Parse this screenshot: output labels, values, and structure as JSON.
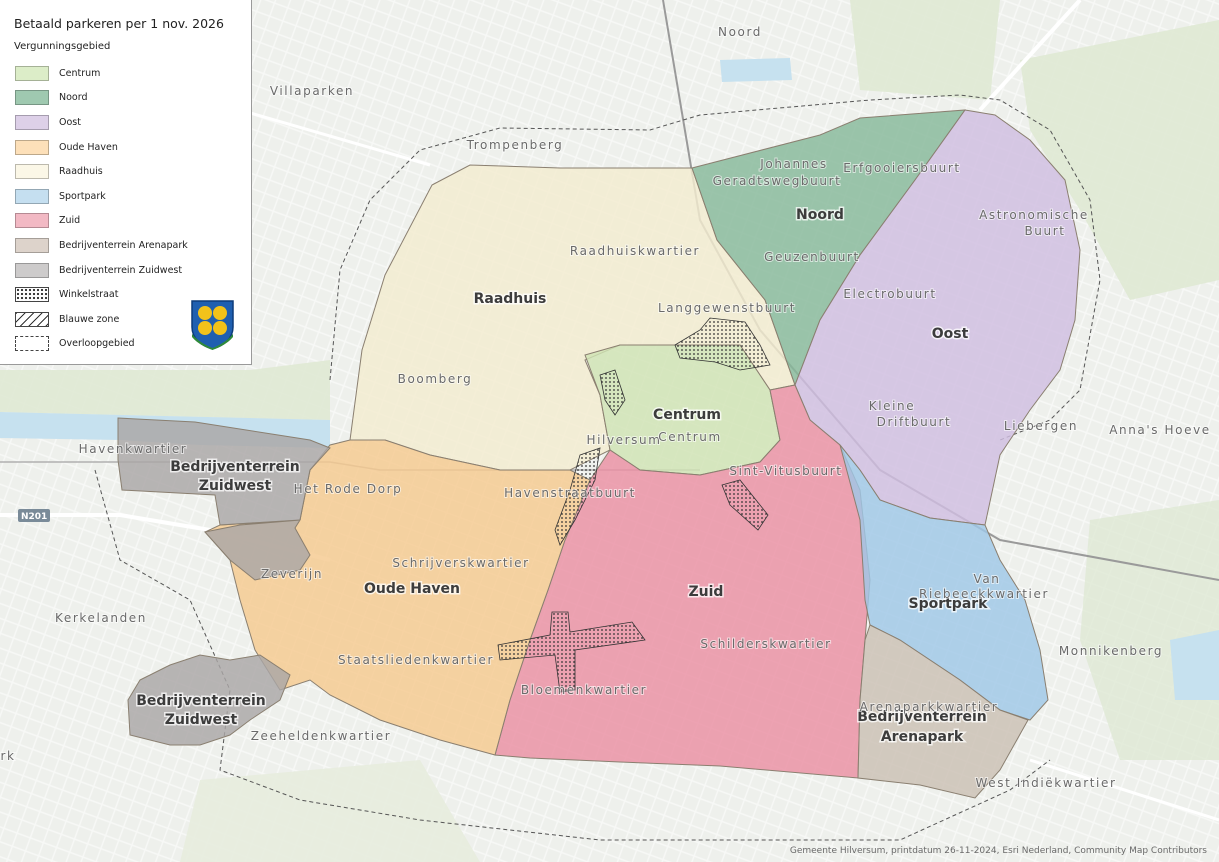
{
  "legend": {
    "title": "Betaald parkeren per 1 nov. 2026",
    "subtitle": "Vergunningsgebied",
    "items": [
      {
        "label": "Centrum",
        "color": "#dcedc8",
        "style": "fill"
      },
      {
        "label": "Noord",
        "color": "#9fc9b0",
        "style": "fill"
      },
      {
        "label": "Oost",
        "color": "#ddd0e8",
        "style": "fill"
      },
      {
        "label": "Oude Haven",
        "color": "#fde0b9",
        "style": "fill"
      },
      {
        "label": "Raadhuis",
        "color": "#fbf7e7",
        "style": "fill"
      },
      {
        "label": "Sportpark",
        "color": "#c5dff0",
        "style": "fill"
      },
      {
        "label": "Zuid",
        "color": "#f2b9c4",
        "style": "fill"
      },
      {
        "label": "Bedrijventerrein Arenapark",
        "color": "#ddd3cb",
        "style": "fill"
      },
      {
        "label": "Bedrijventerrein Zuidwest",
        "color": "#cdcbcb",
        "style": "fill"
      },
      {
        "label": "Winkelstraat",
        "color": "#333333",
        "style": "dots"
      },
      {
        "label": "Blauwe zone",
        "color": "#333333",
        "style": "hatch"
      },
      {
        "label": "Overloopgebied",
        "color": "#444444",
        "style": "dashed"
      }
    ],
    "coat_of_arms": "hilversum-coat-of-arms-icon"
  },
  "zones": {
    "centrum": {
      "label": "Centrum",
      "color": "#cfe3b3"
    },
    "noord": {
      "label": "Noord",
      "color": "#86b89a"
    },
    "oost": {
      "label": "Oost",
      "color": "#cfbde0"
    },
    "oude_haven": {
      "label": "Oude Haven",
      "color": "#f5c98f"
    },
    "raadhuis": {
      "label": "Raadhuis",
      "color": "#f3ecd0"
    },
    "sportpark": {
      "label": "Sportpark",
      "color": "#9fc7e6"
    },
    "zuid": {
      "label": "Zuid",
      "color": "#ea8fa2"
    },
    "arenapark": {
      "label_line1": "Bedrijventerrein",
      "label_line2": "Arenapark",
      "color": "#cbbfb3"
    },
    "zuidwest_north": {
      "label_line1": "Bedrijventerrein",
      "label_line2": "Zuidwest",
      "color": "#a9a6a6"
    },
    "zuidwest_south": {
      "label_line1": "Bedrijventerrein",
      "label_line2": "Zuidwest",
      "color": "#a9a6a6"
    }
  },
  "neighborhoods": {
    "noord_top": "Noord",
    "villaparken": "Villaparken",
    "trompenberg": "Trompenberg",
    "johannes_1": "Johannes",
    "johannes_2": "Geradtswegbuurt",
    "erfgooiersbuurt": "Erfgooiersbuurt",
    "astronomische_1": "Astronomische",
    "astronomische_2": "Buurt",
    "raadhuiskwartier": "Raadhuiskwartier",
    "geuzenbuurt": "Geuzenbuurt",
    "electrobuurt": "Electrobuurt",
    "langgewenstbuurt": "Langgewenstbuurt",
    "boomberg": "Boomberg",
    "kleine_drift_1": "Kleine",
    "kleine_drift_2": "Driftbuurt",
    "liebergen": "Liebergen",
    "annas_hoeve": "Anna's Hoeve",
    "hilversum": "Hilversum",
    "centrum_nbh": "Centrum",
    "havenkwartier": "Havenkwartier",
    "sint_vitusbuurt": "Sint-Vitusbuurt",
    "het_rode_dorp": "Het Rode Dorp",
    "havenstraatbuurt": "Havenstraatbuurt",
    "schrijverskwartier": "Schrijverskwartier",
    "zeverijn": "Zeverijn",
    "van_riebeeck_1": "Van",
    "van_riebeeck_2": "Riebeeckkwartier",
    "kerkelanden": "Kerkelanden",
    "schilderskwartier": "Schilderskwartier",
    "monnikenberg": "Monnikenberg",
    "staatsliedenkwartier": "Staatsliedenkwartier",
    "bloemenkwartier": "Bloemenkwartier",
    "arenaparkkwartier": "Arenaparkkwartier",
    "zeeheldenkwartier": "Zeeheldenkwartier",
    "west_indiekwartier": "West Indiëkwartier",
    "park": "rk"
  },
  "road_shield": "N201",
  "credits": "Gemeente Hilversum, printdatum 26-11-2024, Esri Nederland, Community Map Contributors"
}
